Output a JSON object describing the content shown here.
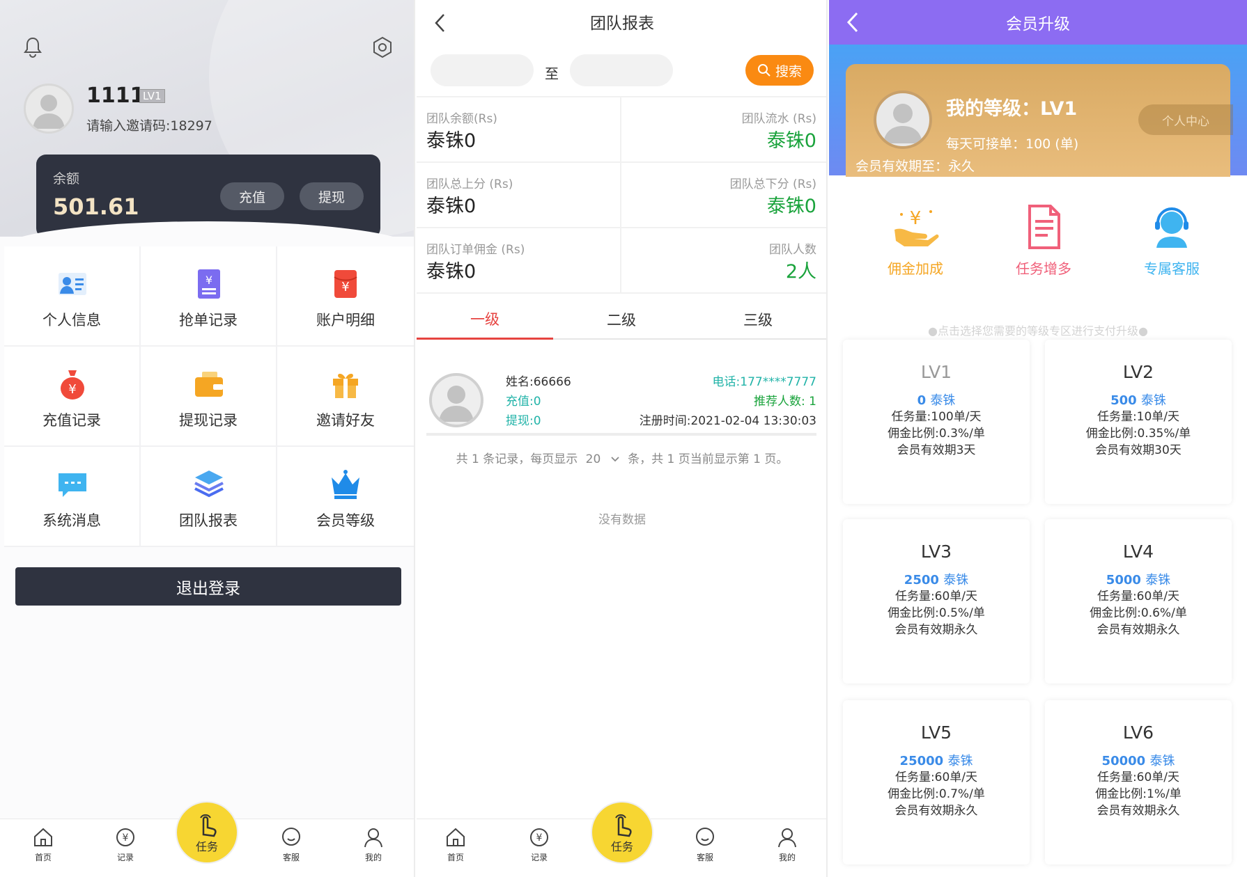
{
  "profile_screen": {
    "username": "1111",
    "level_badge": "LV1",
    "invite_text": "请输入邀请码:18297",
    "balance_label": "余额",
    "balance_value": "501.61",
    "recharge_label": "充值",
    "withdraw_label": "提现",
    "menu": [
      {
        "label": "个人信息",
        "icon": "id-card-icon",
        "color": "#3a8be8"
      },
      {
        "label": "抢单记录",
        "icon": "voucher-icon",
        "color": "#7b6cf0"
      },
      {
        "label": "账户明细",
        "icon": "red-envelope-icon",
        "color": "#f04a3a"
      },
      {
        "label": "充值记录",
        "icon": "money-bag-icon",
        "color": "#f04a3a"
      },
      {
        "label": "提现记录",
        "icon": "wallet-icon",
        "color": "#f5a623"
      },
      {
        "label": "邀请好友",
        "icon": "gift-icon",
        "color": "#f5a623"
      },
      {
        "label": "系统消息",
        "icon": "chat-bubble-icon",
        "color": "#3fb4f0"
      },
      {
        "label": "团队报表",
        "icon": "layers-icon",
        "color": "#4a6cf0"
      },
      {
        "label": "会员等级",
        "icon": "crown-icon",
        "color": "#1f8be8"
      }
    ],
    "logout_label": "退出登录"
  },
  "tabbar": {
    "home": "首页",
    "records": "记录",
    "task": "任务",
    "service": "客服",
    "mine": "我的"
  },
  "team_report": {
    "title": "团队报表",
    "date_separator": "至",
    "search_label": "搜索",
    "stats": [
      {
        "label": "团队余额(Rs)",
        "value": "泰铢0"
      },
      {
        "label": "团队流水 (Rs)",
        "value": "泰铢0"
      },
      {
        "label": "团队总上分 (Rs)",
        "value": "泰铢0"
      },
      {
        "label": "团队总下分 (Rs)",
        "value": "泰铢0"
      },
      {
        "label": "团队订单佣金 (Rs)",
        "value": "泰铢0"
      },
      {
        "label": "团队人数",
        "value": "2人"
      }
    ],
    "level_tabs": [
      "一级",
      "二级",
      "三级"
    ],
    "member": {
      "name": "姓名:66666",
      "recharge": "充值:0",
      "withdraw": "提现:0",
      "phone": "电话:177****7777",
      "referrals": "推荐人数: 1",
      "registered": "注册时间:2021-02-04 13:30:03"
    },
    "pagination_prefix": "共 1 条记录，每页显示",
    "page_size": "20",
    "pagination_suffix": "条，共 1 页当前显示第 1 页。",
    "no_data": "没有数据",
    "accent_color": "#e64340",
    "green_color": "#1aa33c",
    "teal_color": "#21b3a8"
  },
  "vip_upgrade": {
    "title": "会员升级",
    "my_level": "我的等级：LV1",
    "daily_orders": "每天可接单：100 (单)",
    "validity": "会员有效期至：永久",
    "center_button": "个人中心",
    "perks": [
      {
        "label": "佣金加成",
        "color": "#f5a623",
        "icon": "commission-icon"
      },
      {
        "label": "任务增多",
        "color": "#f0607a",
        "icon": "task-document-icon"
      },
      {
        "label": "专属客服",
        "color": "#3fb4f0",
        "icon": "customer-service-icon"
      }
    ],
    "hint": "●点击选择您需要的等级专区进行支付升级●",
    "levels": [
      {
        "name": "LV1",
        "price": "0",
        "currency": "泰铢",
        "tasks": "任务量:100单/天",
        "ratio": "佣金比例:0.3%/单",
        "validity": "会员有效期3天"
      },
      {
        "name": "LV2",
        "price": "500",
        "currency": "泰铢",
        "tasks": "任务量:10单/天",
        "ratio": "佣金比例:0.35%/单",
        "validity": "会员有效期30天"
      },
      {
        "name": "LV3",
        "price": "2500",
        "currency": "泰铢",
        "tasks": "任务量:60单/天",
        "ratio": "佣金比例:0.5%/单",
        "validity": "会员有效期永久"
      },
      {
        "name": "LV4",
        "price": "5000",
        "currency": "泰铢",
        "tasks": "任务量:60单/天",
        "ratio": "佣金比例:0.6%/单",
        "validity": "会员有效期永久"
      },
      {
        "name": "LV5",
        "price": "25000",
        "currency": "泰铢",
        "tasks": "任务量:60单/天",
        "ratio": "佣金比例:0.7%/单",
        "validity": "会员有效期永久"
      },
      {
        "name": "LV6",
        "price": "50000",
        "currency": "泰铢",
        "tasks": "任务量:60单/天",
        "ratio": "佣金比例:1%/单",
        "validity": "会员有效期永久"
      }
    ],
    "header_color": "#8c6cf2",
    "price_color": "#3a8be8"
  }
}
